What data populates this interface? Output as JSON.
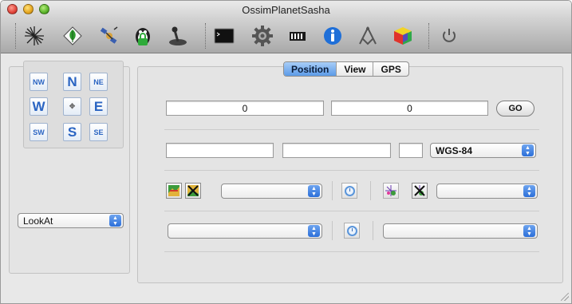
{
  "window": {
    "title": "OssimPlanetSasha"
  },
  "toolbar": {
    "buttons": [
      {
        "icon": "sparkle-crosshair-icon"
      },
      {
        "icon": "leaf-diamond-icon"
      },
      {
        "icon": "satellite-icon"
      },
      {
        "icon": "penguin-lock-icon"
      },
      {
        "icon": "joystick-icon"
      },
      {
        "icon": "terminal-icon"
      },
      {
        "icon": "gear-icon"
      },
      {
        "icon": "film-strip-icon"
      },
      {
        "icon": "info-icon"
      },
      {
        "icon": "compass-square-icon"
      },
      {
        "icon": "color-cube-icon"
      },
      {
        "icon": "power-icon"
      }
    ]
  },
  "navigation": {
    "nw": "NW",
    "n": "N",
    "ne": "NE",
    "w": "W",
    "center": "✥",
    "e": "E",
    "sw": "SW",
    "s": "S",
    "se": "SE"
  },
  "mode_popup": {
    "selected": "LookAt"
  },
  "tabs": [
    {
      "label": "Position",
      "active": true
    },
    {
      "label": "View",
      "active": false
    },
    {
      "label": "GPS",
      "active": false
    }
  ],
  "position": {
    "lat_value": "0",
    "lon_value": "0",
    "go_label": "GO",
    "coord_field_1": "",
    "coord_field_2": "",
    "coord_field_3": "",
    "datum_selected": "WGS-84",
    "row3_popup_1": "",
    "row3_popup_2": "",
    "row4_popup_1": "",
    "row4_popup_2": ""
  },
  "colors": {
    "accent": "#2c6fd9",
    "nav_text": "#2a64c2"
  }
}
